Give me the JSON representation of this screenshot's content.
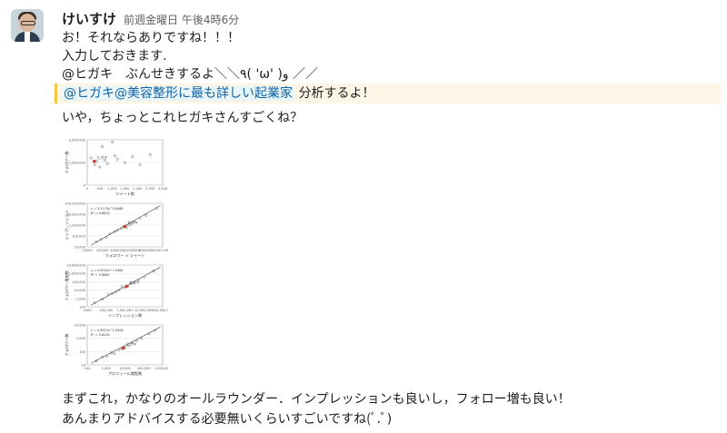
{
  "message": {
    "author": "けいすけ",
    "timestamp": "前週金曜日 午後4時6分",
    "lines": [
      "お！それならありですね！！！",
      "入力しておきます.",
      "@ヒガキ　ぶんせきするよ＼＼٩( 'ω' )و ／／"
    ],
    "highlight_mention": "@ヒガキ@美容整形に最も詳しい起業家",
    "highlight_rest": " 分析するよ！",
    "after_line": "いや，ちょっとこれヒガキさんすごくね？",
    "closing_lines": [
      "まずこれ，かなりのオールラウンダー．インプレッションも良いし，フォロー増も良い！",
      "あんまりアドバイスする必要無いくらいすごいですね(ﾟ.ﾟ)"
    ]
  },
  "chart_data": [
    {
      "type": "scatter",
      "xlabel": "ツイート数",
      "ylabel": "フォロワー数",
      "x_ticks": [
        "0",
        "500",
        "1,000",
        "1,500",
        "2,000",
        "2,500",
        "3,000"
      ],
      "y_ticks": [
        "2,000,000",
        "1,000,000",
        "0"
      ],
      "highlight_label": "ヒガキ",
      "points": [
        [
          150,
          1200000
        ],
        [
          300,
          900000
        ],
        [
          380,
          1050000
        ],
        [
          500,
          800000
        ],
        [
          700,
          1100000
        ],
        [
          800,
          950000
        ],
        [
          1000,
          1900000
        ],
        [
          1100,
          1300000
        ],
        [
          1200,
          1150000
        ],
        [
          1500,
          1000000
        ],
        [
          1800,
          1250000
        ],
        [
          2100,
          900000
        ],
        [
          2500,
          1350000
        ],
        [
          600,
          1700000
        ]
      ],
      "highlight_point": [
        280,
        1050000
      ]
    },
    {
      "type": "scatter",
      "xlabel": "フォロワー × ツイート",
      "ylabel": "インプレッション",
      "annotation": [
        "y = 3.5175x^0.8066",
        "R² = 0.8810"
      ],
      "x_ticks": [
        "10000",
        "100000",
        "1000000",
        "10000000",
        "100000000",
        "1E+09"
      ],
      "y_ticks": [
        "100,000,000",
        "10,000,000",
        "1,000,000",
        "100,000",
        "10,000"
      ],
      "highlight_label": "ヒガキ",
      "points": [
        [
          0.12,
          0.12
        ],
        [
          0.18,
          0.17
        ],
        [
          0.25,
          0.22
        ],
        [
          0.3,
          0.3
        ],
        [
          0.36,
          0.35
        ],
        [
          0.4,
          0.38
        ],
        [
          0.45,
          0.42
        ],
        [
          0.48,
          0.46
        ],
        [
          0.52,
          0.44
        ],
        [
          0.55,
          0.5
        ],
        [
          0.58,
          0.52
        ],
        [
          0.62,
          0.58
        ],
        [
          0.7,
          0.66
        ],
        [
          0.78,
          0.72
        ],
        [
          0.92,
          0.88
        ]
      ],
      "highlight_point": [
        0.5,
        0.47
      ]
    },
    {
      "type": "scatter",
      "xlabel": "インプレッション数",
      "ylabel": "フォロワー増加数",
      "annotation": [
        "y = 0.0032x^1.0484",
        "R² = 0.8640"
      ],
      "x_ticks": [
        "1000",
        "100,000",
        "1,000,000",
        "10,000,000",
        "100,000,000"
      ],
      "y_ticks": [
        "10,000,000",
        "1,000,000",
        "100,000",
        "10,000",
        "1,000",
        "100"
      ],
      "highlight_label": "ヒガキ",
      "points": [
        [
          0.1,
          0.1
        ],
        [
          0.2,
          0.18
        ],
        [
          0.28,
          0.3
        ],
        [
          0.33,
          0.32
        ],
        [
          0.38,
          0.36
        ],
        [
          0.42,
          0.4
        ],
        [
          0.46,
          0.48
        ],
        [
          0.5,
          0.46
        ],
        [
          0.54,
          0.5
        ],
        [
          0.58,
          0.56
        ],
        [
          0.62,
          0.58
        ],
        [
          0.68,
          0.64
        ],
        [
          0.76,
          0.72
        ],
        [
          0.88,
          0.86
        ]
      ],
      "highlight_point": [
        0.52,
        0.49
      ]
    },
    {
      "type": "scatter",
      "xlabel": "プロフィール閲覧数",
      "ylabel": "フォロワー数",
      "annotation": [
        "y = 0.9912x^1.0006",
        "R² = 0.8216"
      ],
      "x_ticks": [
        "100",
        "1,000",
        "10,000",
        "100,000",
        "1,000,000"
      ],
      "y_ticks": [
        "10,000",
        "1,000",
        "100",
        "10"
      ],
      "highlight_label": "ヒガキ",
      "points": [
        [
          0.12,
          0.1
        ],
        [
          0.2,
          0.2
        ],
        [
          0.26,
          0.22
        ],
        [
          0.32,
          0.3
        ],
        [
          0.36,
          0.28
        ],
        [
          0.42,
          0.38
        ],
        [
          0.46,
          0.4
        ],
        [
          0.5,
          0.44
        ],
        [
          0.55,
          0.48
        ],
        [
          0.6,
          0.56
        ],
        [
          0.66,
          0.6
        ],
        [
          0.72,
          0.66
        ],
        [
          0.82,
          0.78
        ],
        [
          0.9,
          0.86
        ]
      ],
      "highlight_point": [
        0.48,
        0.42
      ]
    }
  ]
}
